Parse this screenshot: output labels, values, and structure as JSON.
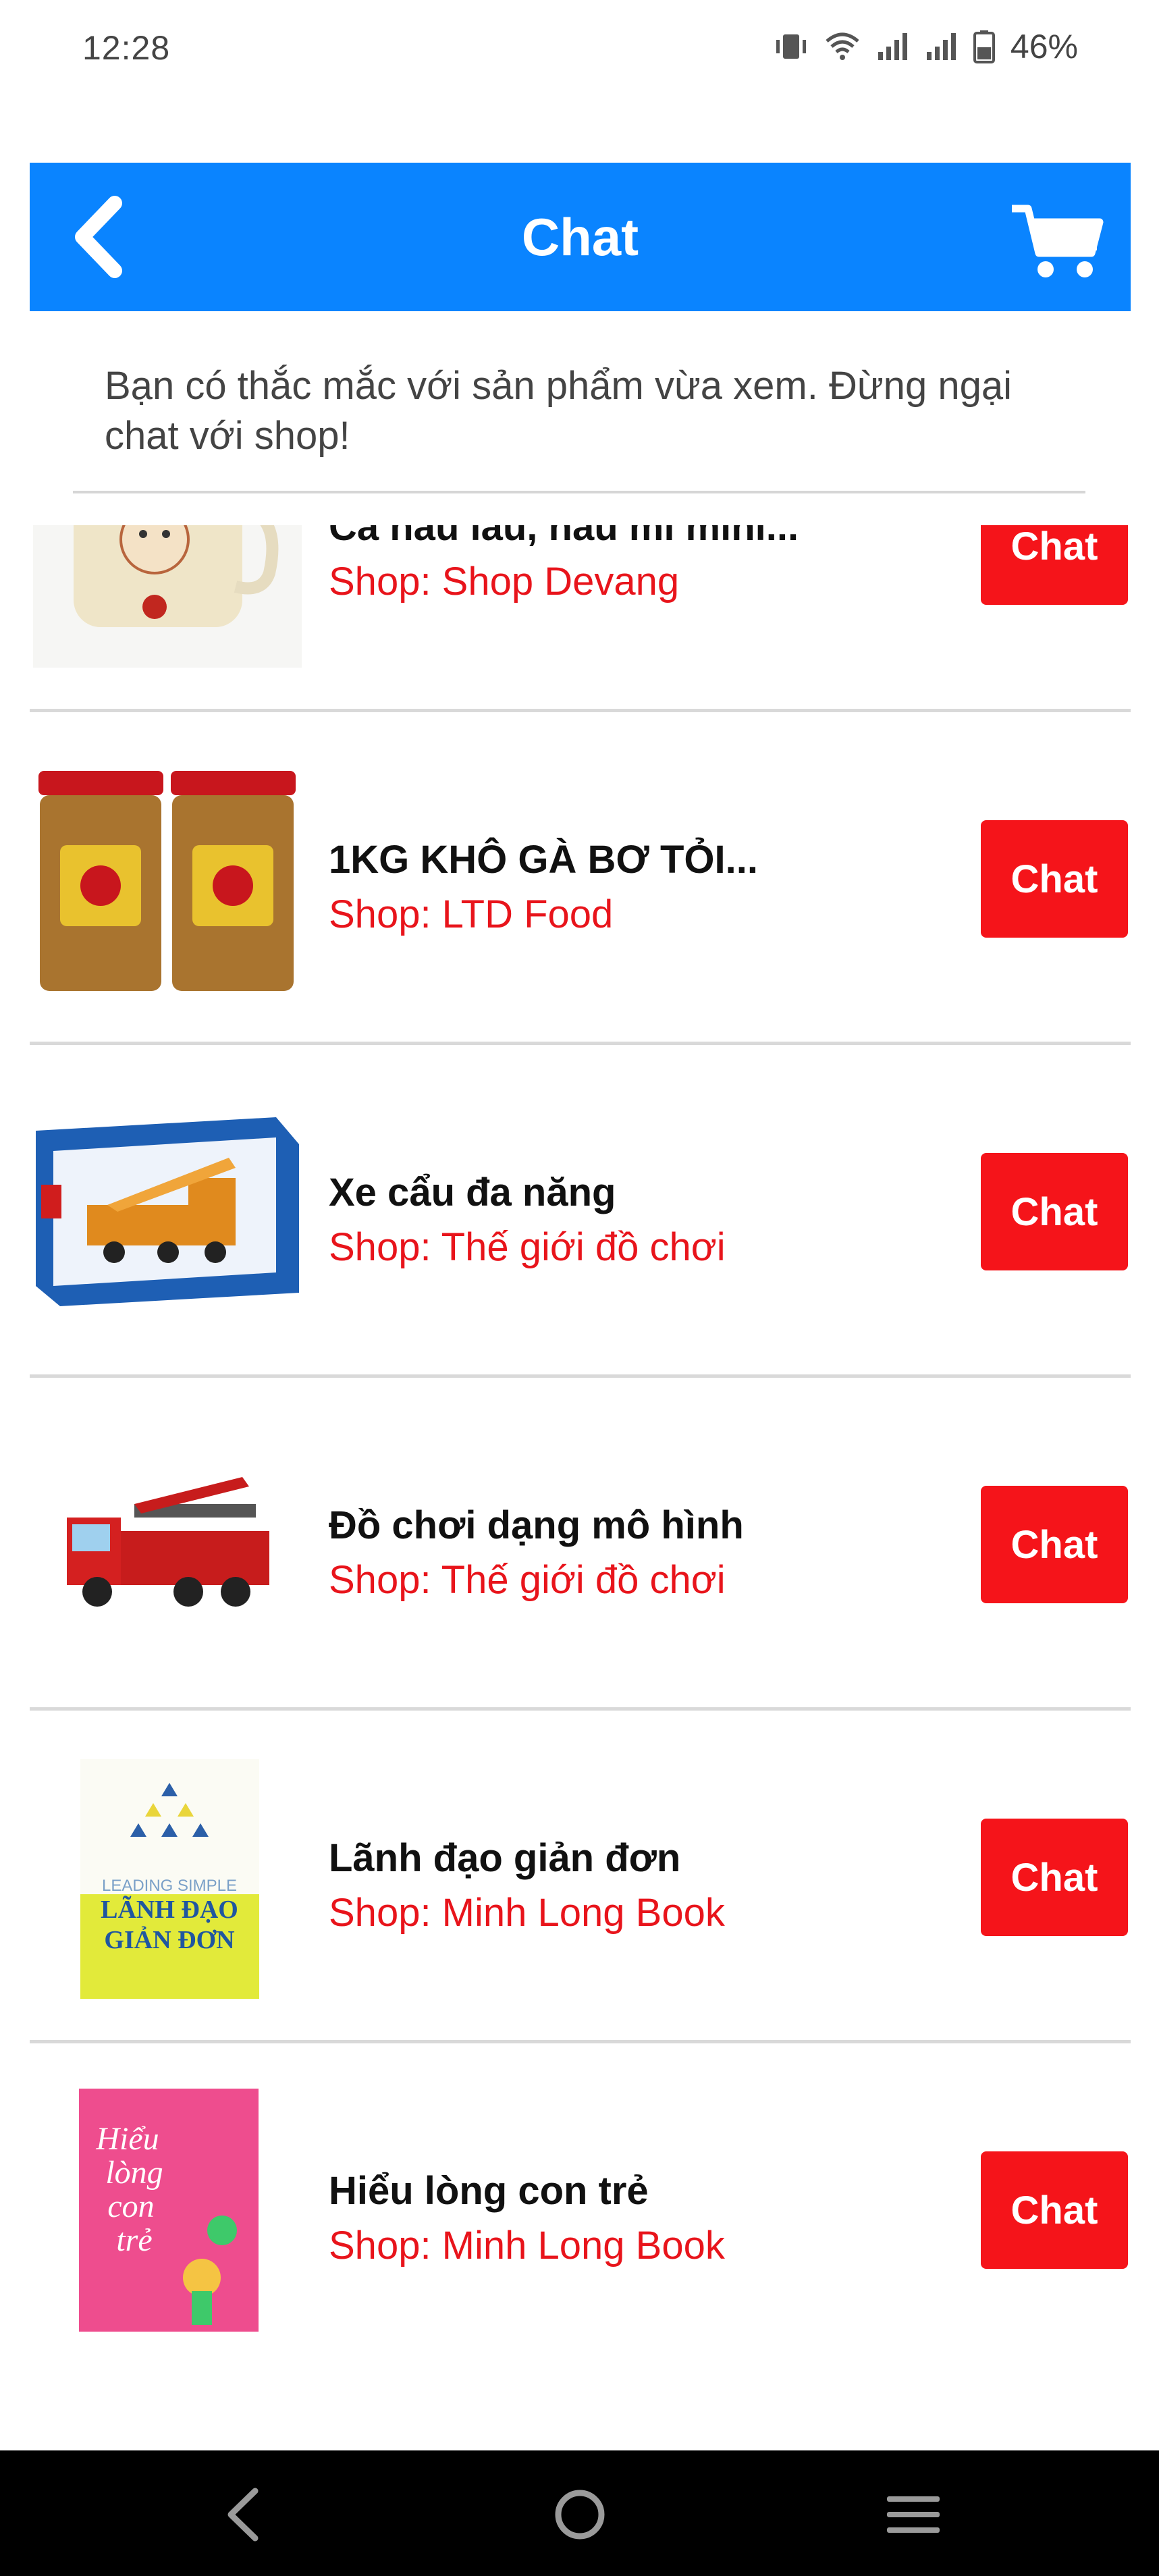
{
  "status_bar": {
    "time": "12:28",
    "battery": "46%",
    "icons": [
      "vibrate-icon",
      "wifi-icon",
      "signal-icon",
      "signal-icon",
      "battery-icon"
    ]
  },
  "header": {
    "title": "Chat",
    "back_icon": "back-chevron-icon",
    "cart_icon": "cart-icon",
    "color": "#0a84ff"
  },
  "intro": {
    "text": "Bạn có thắc mắc với sản phẩm vừa xem. Đừng ngại chat với shop!"
  },
  "products": [
    {
      "name": "Ca nấu lẩu, nấu mì mini...",
      "shop": "Shop: Shop Devang",
      "button": "Chat",
      "thumb": "pot"
    },
    {
      "name": "1KG KHÔ GÀ BƠ TỎI...",
      "shop": "Shop: LTD Food",
      "button": "Chat",
      "thumb": "jars"
    },
    {
      "name": "Xe cẩu đa năng",
      "shop": "Shop: Thế giới đồ chơi",
      "button": "Chat",
      "thumb": "crane-box"
    },
    {
      "name": "Đồ chơi dạng mô hình",
      "shop": "Shop: Thế giới đồ chơi",
      "button": "Chat",
      "thumb": "fire-truck"
    },
    {
      "name": "Lãnh đạo giản đơn",
      "shop": "Shop: Minh Long Book",
      "button": "Chat",
      "thumb": "book-yellow",
      "thumb_text": [
        "LEADING SIMPLE",
        "LÃNH ĐẠO",
        "GIẢN ĐƠN"
      ]
    },
    {
      "name": "Hiểu lòng con trẻ",
      "shop": "Shop: Minh Long Book",
      "button": "Chat",
      "thumb": "book-pink",
      "thumb_text": [
        "Hiểu",
        "lòng",
        "con",
        "trẻ"
      ]
    }
  ],
  "nav": {
    "back": "nav-back-icon",
    "home": "nav-home-icon",
    "menu": "nav-menu-icon"
  },
  "colors": {
    "accent": "#0a84ff",
    "chat_button": "#f5141a",
    "shop_text": "#e8141b"
  }
}
